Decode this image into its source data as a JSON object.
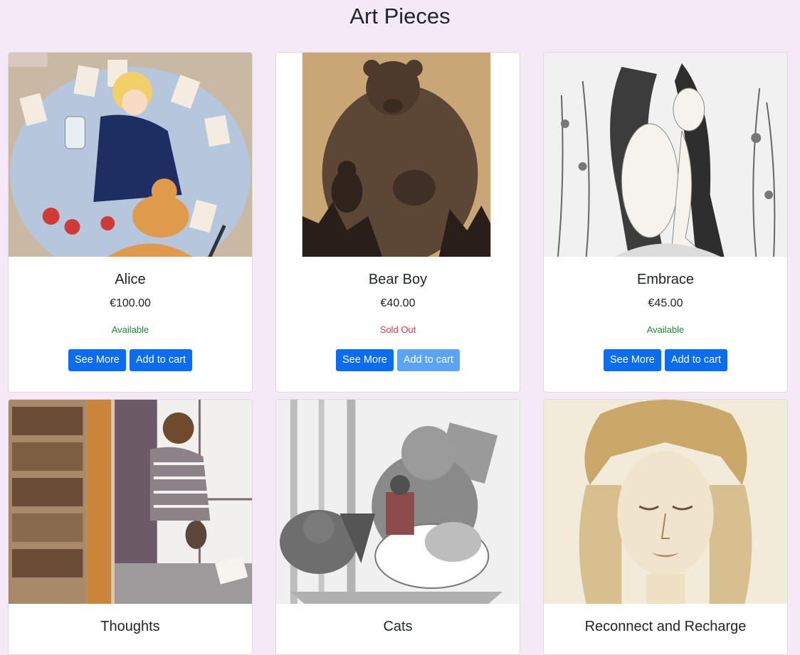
{
  "page": {
    "title": "Art Pieces"
  },
  "colors": {
    "background": "#f5e9f7",
    "button": "#0a6cf1",
    "button_disabled": "#5aa3f5",
    "available": "#1e8a3a",
    "sold_out": "#dc3545"
  },
  "cards": [
    {
      "title": "Alice",
      "price": "€100.00",
      "status": "Available",
      "see_more": "See More",
      "add_to_cart": "Add to cart",
      "image": "alice-artwork"
    },
    {
      "title": "Bear Boy",
      "price": "€40.00",
      "status": "Sold Out",
      "see_more": "See More",
      "add_to_cart": "Add to cart",
      "image": "bear-boy-artwork"
    },
    {
      "title": "Embrace",
      "price": "€45.00",
      "status": "Available",
      "see_more": "See More",
      "add_to_cart": "Add to cart",
      "image": "embrace-artwork"
    },
    {
      "title": "Thoughts",
      "image": "thoughts-artwork"
    },
    {
      "title": "Cats",
      "image": "cats-artwork"
    },
    {
      "title": "Reconnect and Recharge",
      "image": "reconnect-artwork"
    }
  ]
}
